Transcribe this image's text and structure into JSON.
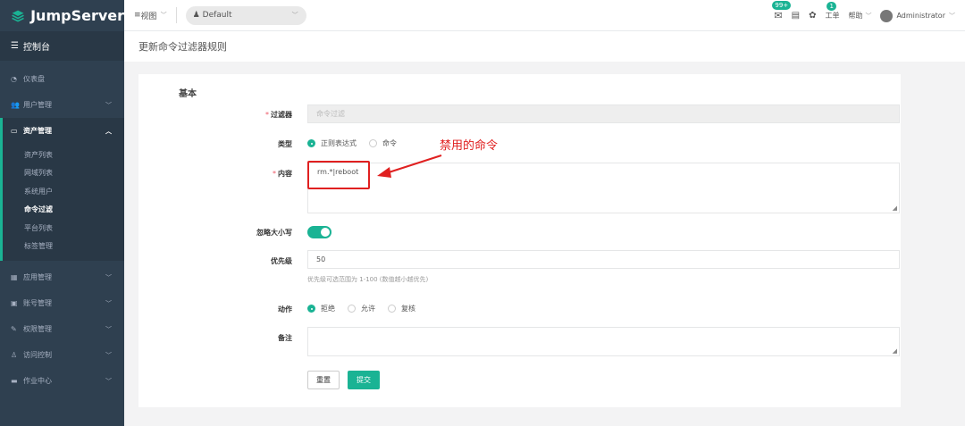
{
  "brand": {
    "name": "JumpServer"
  },
  "sidebar": {
    "top": {
      "label": "控制台"
    },
    "items": [
      {
        "label": "仪表盘",
        "icon": "dashboard-icon",
        "has_children": false
      },
      {
        "label": "用户管理",
        "icon": "users-icon",
        "has_children": true
      },
      {
        "label": "资产管理",
        "icon": "inbox-icon",
        "has_children": true,
        "active": true,
        "children": [
          "资产列表",
          "网域列表",
          "系统用户",
          "命令过滤",
          "平台列表",
          "标签管理"
        ],
        "current_child": "命令过滤"
      },
      {
        "label": "应用管理",
        "icon": "grid-icon",
        "has_children": true
      },
      {
        "label": "账号管理",
        "icon": "account-icon",
        "has_children": true
      },
      {
        "label": "权限管理",
        "icon": "edit-icon",
        "has_children": true
      },
      {
        "label": "访问控制",
        "icon": "sitemap-icon",
        "has_children": true
      },
      {
        "label": "作业中心",
        "icon": "terminal-icon",
        "has_children": true
      }
    ]
  },
  "topbar": {
    "view_label": "视图",
    "org": "Default",
    "mail_badge": "99+",
    "ticket_label": "工单",
    "ticket_badge": "1",
    "help_label": "帮助",
    "user": "Administrator"
  },
  "page": {
    "title": "更新命令过滤器规则"
  },
  "form": {
    "section": "基本",
    "filter": {
      "label": "过滤器",
      "value": "命令过滤"
    },
    "type": {
      "label": "类型",
      "options": [
        "正则表达式",
        "命令"
      ],
      "selected": "正则表达式"
    },
    "content": {
      "label": "内容",
      "value": "rm.*|reboot"
    },
    "ignore_case": {
      "label": "忽略大小写",
      "on": true
    },
    "priority": {
      "label": "优先级",
      "value": "50",
      "help": "优先级可选范围为 1-100 (数值越小越优先)"
    },
    "action": {
      "label": "动作",
      "options": [
        "拒绝",
        "允许",
        "复核"
      ],
      "selected": "拒绝"
    },
    "comment": {
      "label": "备注",
      "value": ""
    },
    "reset_label": "重置",
    "submit_label": "提交"
  },
  "annotation": {
    "text": "禁用的命令",
    "color": "#e02020"
  },
  "colors": {
    "accent": "#1ab394",
    "sidebar_bg": "#2f4050",
    "required": "#ed5565"
  }
}
